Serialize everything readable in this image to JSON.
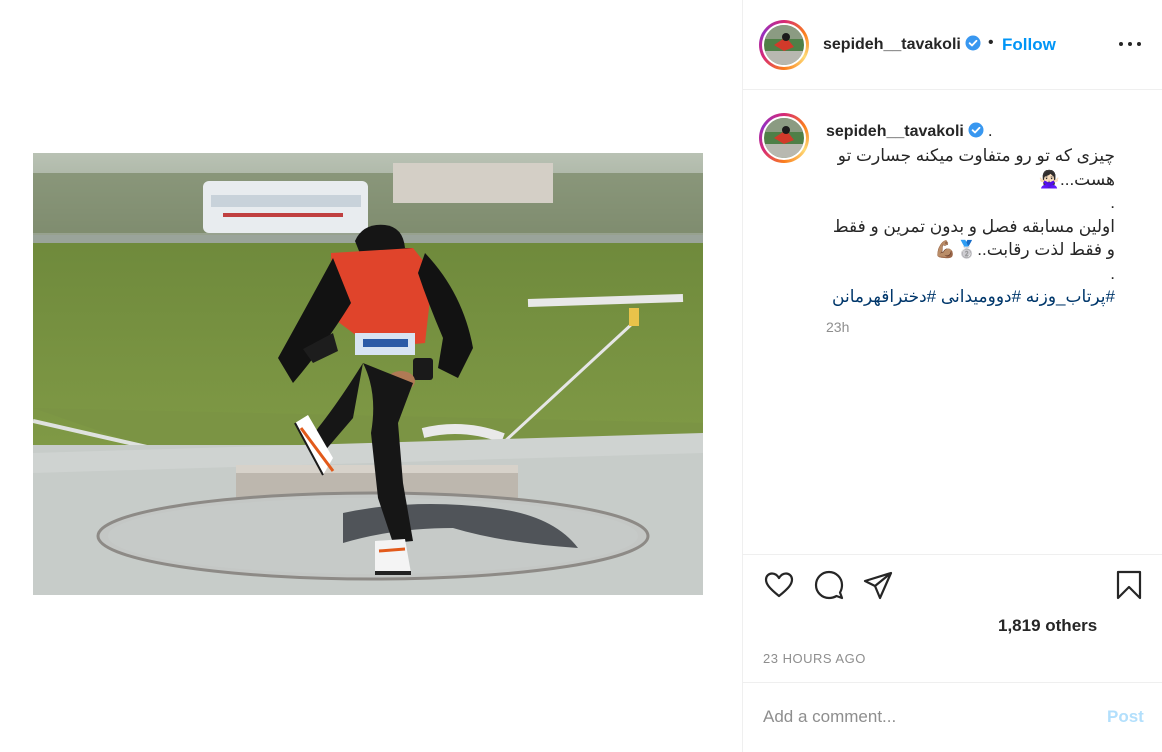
{
  "post": {
    "username": "sepideh__tavakoli",
    "follow_label": "Follow",
    "separator": "•"
  },
  "caption": {
    "username": "sepideh__tavakoli",
    "trailing_dot": ".",
    "lines": [
      "چیزی که تو رو متفاوت میکنه جسارت تو",
      "هست...🙅🏻‍♀️",
      ".",
      "اولین مسابقه فصل و بدون تمرین و فقط",
      "و فقط لذت رقابت..🥈💪🏽",
      "."
    ],
    "hashtags": "#پرتاب_وزنه #دوومیدانی #دختراقهرمانن",
    "time_short": "23h"
  },
  "actions": {
    "likes_text": "1,819 others",
    "time_ago": "23 HOURS AGO"
  },
  "comment": {
    "placeholder": "Add a comment...",
    "post_label": "Post"
  },
  "icons": {
    "like": "heart-icon",
    "comment": "comment-bubble-icon",
    "share": "paper-plane-icon",
    "save": "bookmark-icon",
    "more": "more-options-icon",
    "verified": "verified-badge-icon"
  },
  "colors": {
    "link_blue": "#0095f6",
    "post_disabled": "#b2dffc",
    "hashtag": "#00376b",
    "muted": "#8e8e8e"
  }
}
